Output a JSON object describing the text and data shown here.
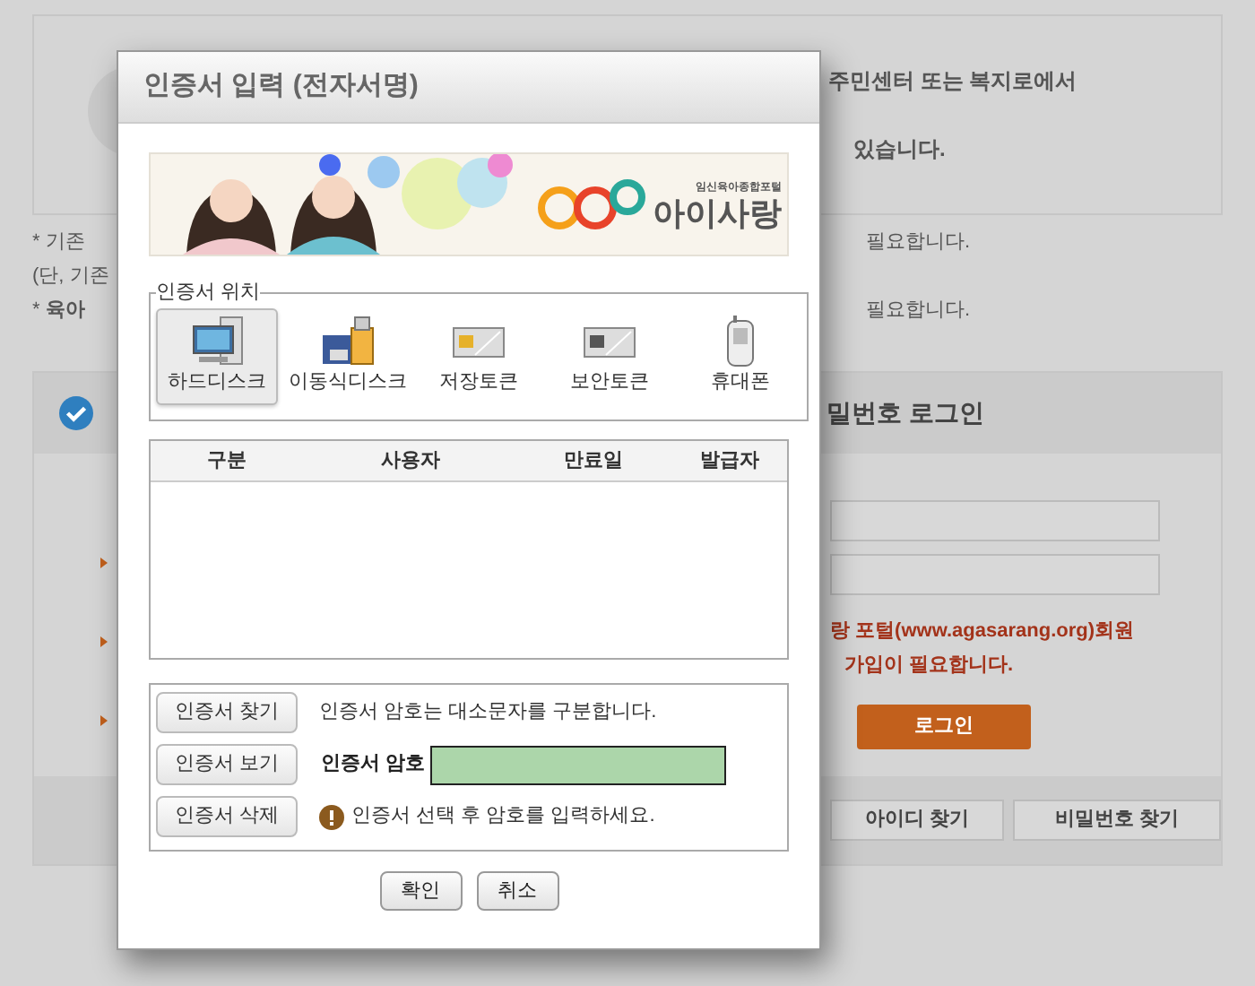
{
  "background_page": {
    "notice_lines": [
      "주민센터 또는 복지로에서",
      "있습니다."
    ],
    "notes": [
      {
        "left": "* 기존",
        "right": "필요합니다."
      },
      {
        "left": "(단, 기존"
      },
      {
        "left": "* **육아**",
        "right": "필요합니다."
      }
    ],
    "login_panel": {
      "title": "밀번호 로그인",
      "notice": [
        "랑 포털(www.agasarang.org)회원",
        "가입이 필요합니다."
      ],
      "login_button": "로그인",
      "links": [
        "아이디 찾기",
        "비밀번호 찾기"
      ]
    }
  },
  "dialog": {
    "title": "인증서 입력 (전자서명)",
    "banner": {
      "tagline": "임신육아종합포털",
      "brand": "아이사랑"
    },
    "location": {
      "legend": "인증서 위치",
      "options": [
        {
          "label": "하드디스크",
          "kind": "harddisk",
          "selected": true
        },
        {
          "label": "이동식디스크",
          "kind": "removable",
          "selected": false
        },
        {
          "label": "저장토큰",
          "kind": "storagetoken",
          "selected": false
        },
        {
          "label": "보안토큰",
          "kind": "securitytoken",
          "selected": false
        },
        {
          "label": "휴대폰",
          "kind": "phone",
          "selected": false
        }
      ]
    },
    "table": {
      "columns": [
        "구분",
        "사용자",
        "만료일",
        "발급자"
      ]
    },
    "side_buttons": [
      "인증서 찾기",
      "인증서 보기",
      "인증서 삭제"
    ],
    "case_note": "인증서 암호는 대소문자를 구분합니다.",
    "password_label": "인증서 암호",
    "warning": "인증서 선택 후 암호를 입력하세요.",
    "actions": [
      "확인",
      "취소"
    ]
  }
}
